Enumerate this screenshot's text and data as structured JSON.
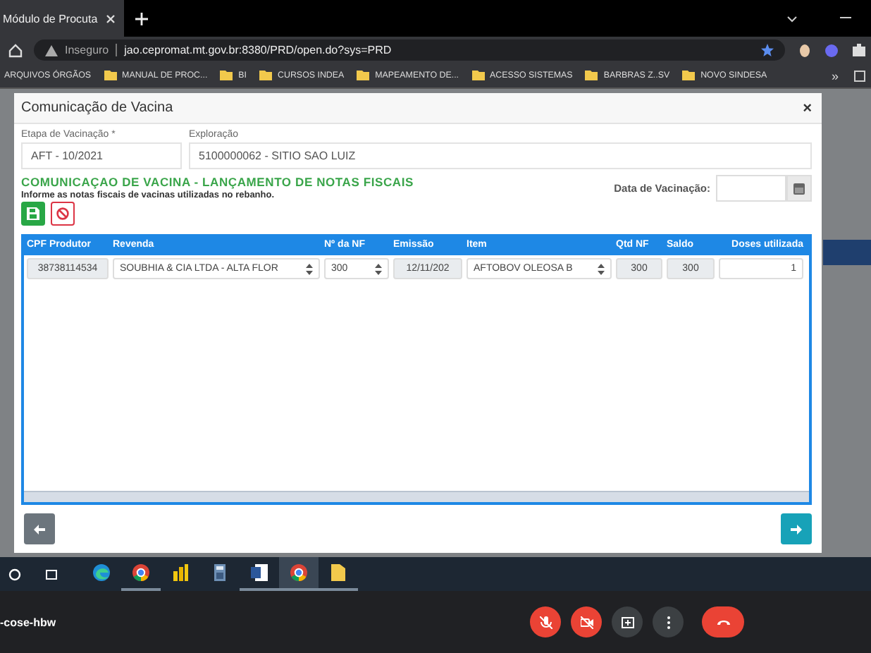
{
  "browser": {
    "tab": {
      "title": "Módulo de Procuta"
    },
    "address": {
      "security": "Inseguro",
      "url": "jao.cepromat.mt.gov.br:8380/PRD/open.do?sys=PRD"
    },
    "bookmarks": [
      {
        "label": "ARQUIVOS ÓRGÃOS",
        "folder": false
      },
      {
        "label": "MANUAL DE PROC...",
        "folder": true
      },
      {
        "label": "BI",
        "folder": true
      },
      {
        "label": "CURSOS INDEA",
        "folder": true
      },
      {
        "label": "MAPEAMENTO DE...",
        "folder": true
      },
      {
        "label": "ACESSO SISTEMAS",
        "folder": true
      },
      {
        "label": "BARBRAS Z..SV",
        "folder": true
      },
      {
        "label": "NOVO SINDESA",
        "folder": true
      }
    ],
    "more": "»"
  },
  "modal": {
    "title": "Comunicação de Vacina",
    "close": "×",
    "fields": [
      {
        "label": "Etapa de Vacinação *",
        "value": "AFT - 10/2021"
      },
      {
        "label": "Exploração",
        "value": "5100000062 - SITIO SAO LUIZ"
      }
    ],
    "section": {
      "title": "COMUNICAÇAO DE VACINA - LANÇAMENTO DE NOTAS FISCAIS",
      "subtitle": "Informe as notas fiscais de vacinas utilizadas no rebanho."
    },
    "date_field": {
      "label": "Data de Vacinação:"
    },
    "table": {
      "columns": [
        "CPF Produtor",
        "Revenda",
        "Nº da NF",
        "Emissão",
        "Item",
        "Qtd NF",
        "Saldo",
        "Doses utilizada"
      ],
      "rows": [
        [
          {
            "kind": "readonly",
            "value": "38738114534"
          },
          {
            "kind": "select",
            "value": "SOUBHIA & CIA LTDA - ALTA FLOR"
          },
          {
            "kind": "select",
            "value": "300"
          },
          {
            "kind": "readonly",
            "value": "12/11/202"
          },
          {
            "kind": "select",
            "value": "AFTOBOV OLEOSA B"
          },
          {
            "kind": "readonly",
            "value": "300"
          },
          {
            "kind": "readonly",
            "value": "300"
          },
          {
            "kind": "input",
            "value": "1"
          }
        ]
      ]
    }
  },
  "taskbar": {
    "apps": [
      {
        "kind": "edge",
        "running": false,
        "selected": false
      },
      {
        "kind": "chrome",
        "running": true,
        "selected": false
      },
      {
        "kind": "chart",
        "running": false,
        "selected": false
      },
      {
        "kind": "calc",
        "running": false,
        "selected": false
      },
      {
        "kind": "word",
        "running": true,
        "selected": false
      },
      {
        "kind": "chrome",
        "running": true,
        "selected": true
      },
      {
        "kind": "folder",
        "running": true,
        "selected": false
      }
    ]
  },
  "meeting": {
    "code": "-cose-hbw",
    "controls": [
      {
        "kind": "mic",
        "off": true
      },
      {
        "kind": "camera",
        "off": true
      },
      {
        "kind": "present",
        "off": false
      },
      {
        "kind": "more",
        "off": false
      },
      {
        "kind": "hangup",
        "off": false
      }
    ]
  }
}
